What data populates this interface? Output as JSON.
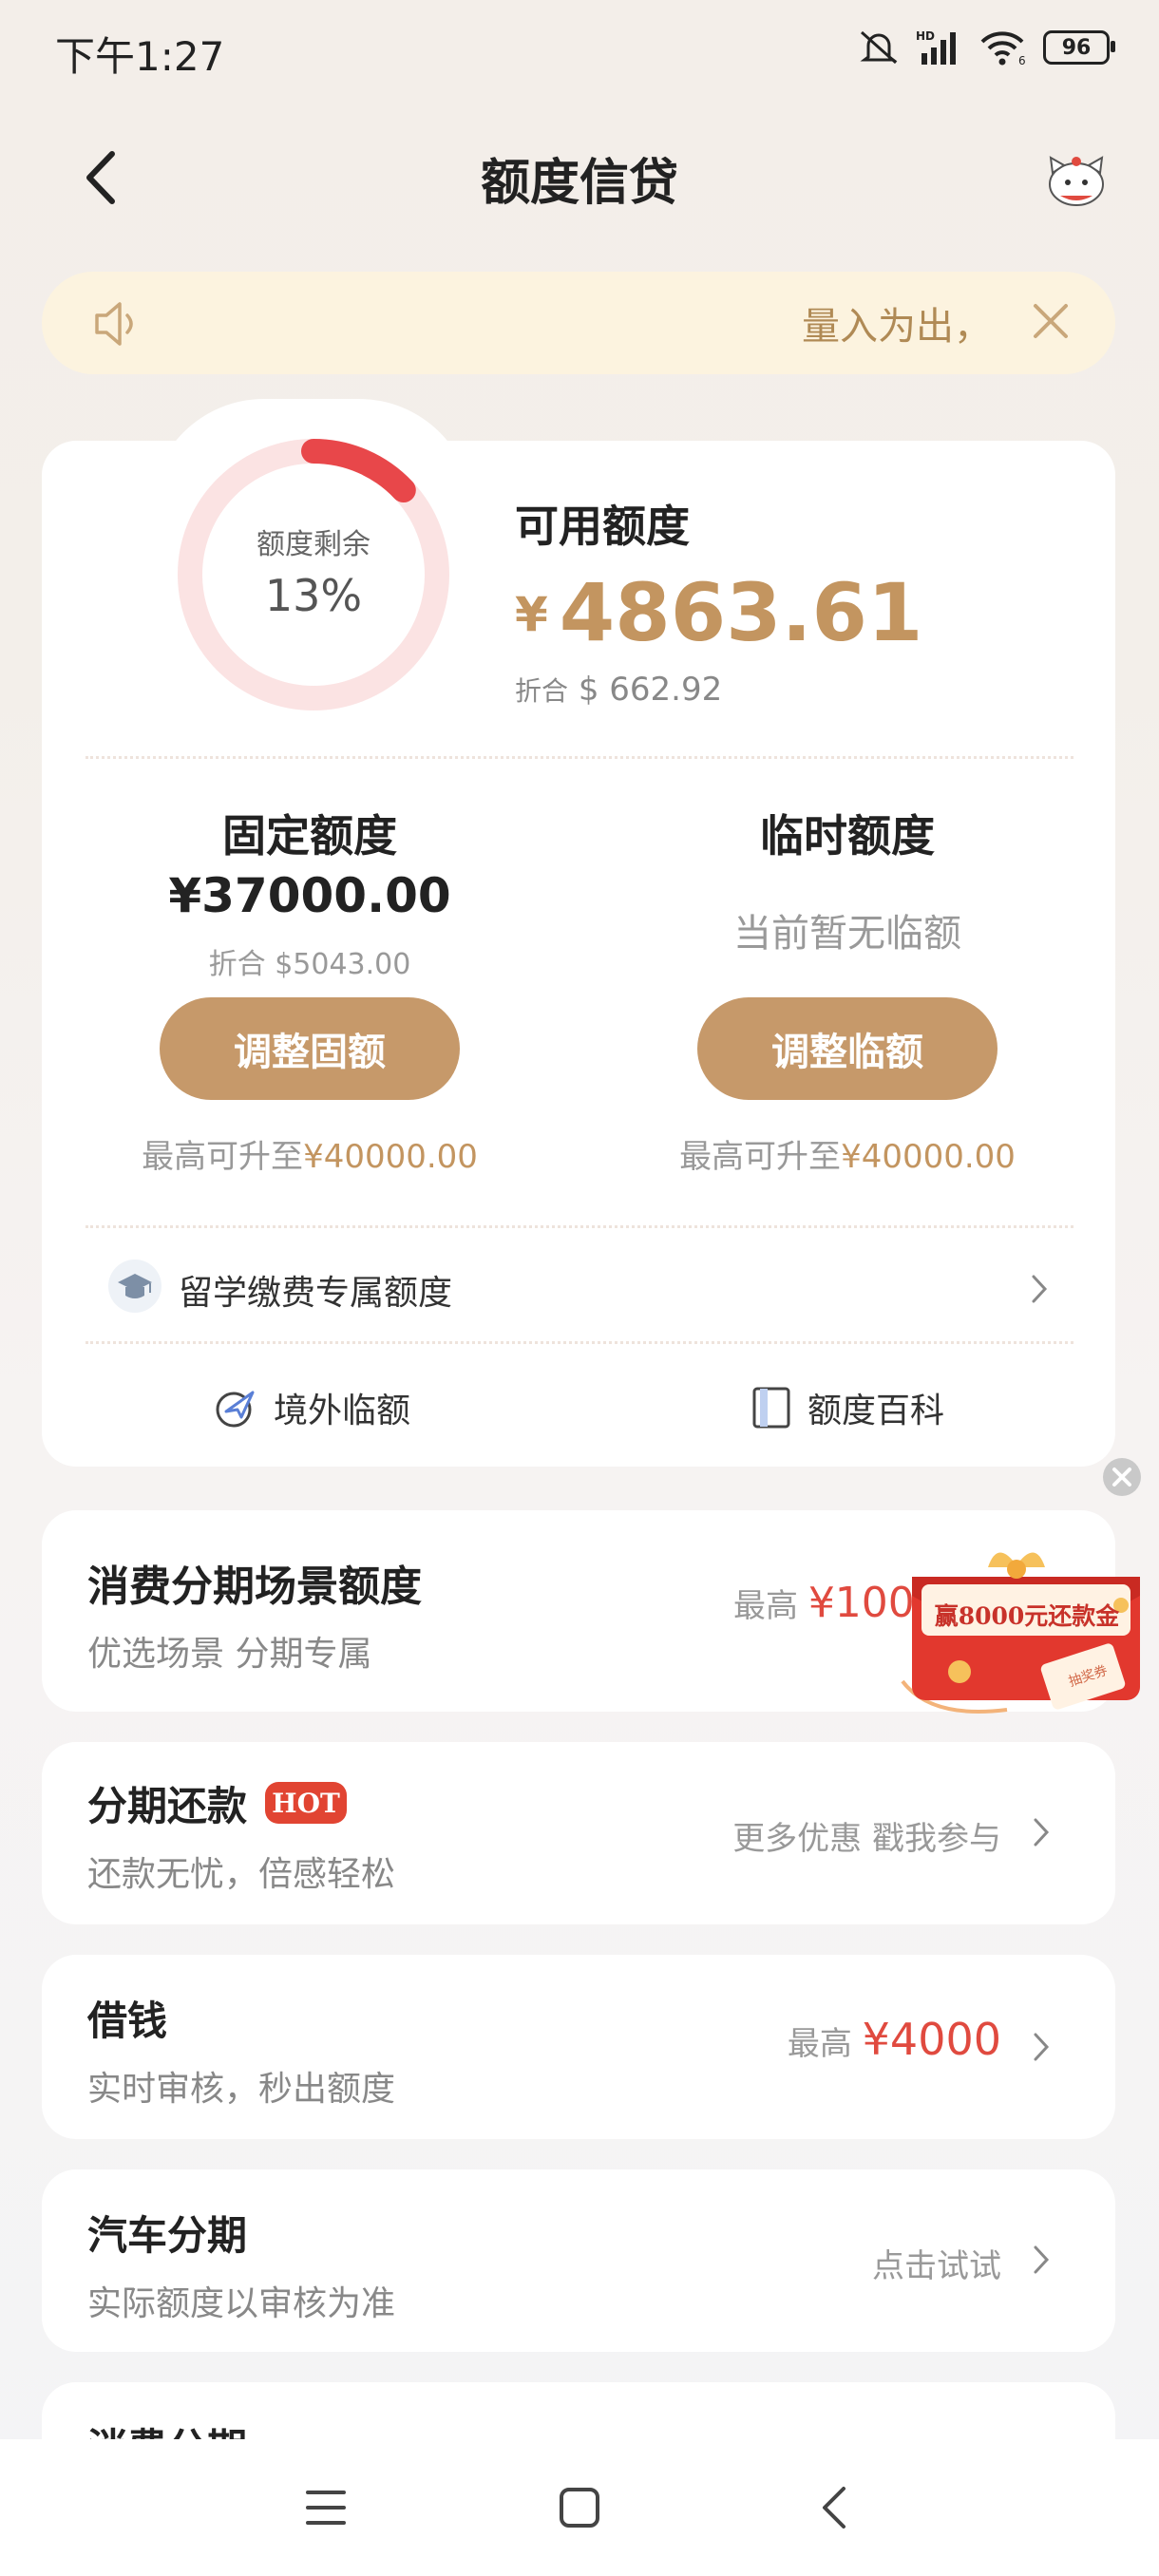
{
  "status": {
    "time": "下午1:27",
    "battery": "96"
  },
  "header": {
    "title": "额度信贷"
  },
  "notice": {
    "text": "量入为出，"
  },
  "quota": {
    "ring_label": "额度剩余",
    "ring_percent": "13%",
    "ring_fraction": 0.13,
    "available_label": "可用额度",
    "currency": "¥",
    "available_amount": "4863.61",
    "conv_label": "折合",
    "conv_currency": "$",
    "conv_amount": "662.92"
  },
  "fixed": {
    "title": "固定额度",
    "amount": "¥37000.00",
    "conv": "折合 $5043.00",
    "button": "调整固额",
    "max_prefix": "最高可升至",
    "max_value": "¥40000.00"
  },
  "temp": {
    "title": "临时额度",
    "none_text": "当前暂无临额",
    "button": "调整临额",
    "max_prefix": "最高可升至",
    "max_value": "¥40000.00"
  },
  "study": {
    "label": "留学缴费专属额度"
  },
  "links": {
    "overseas": "境外临额",
    "wiki": "额度百科"
  },
  "scene": {
    "title": "消费分期场景额度",
    "subtitle": "优选场景 分期专属",
    "right_prefix": "最高",
    "right_value": "¥100",
    "promo": "赢8000元还款金",
    "promo_ticket": "抽奖券"
  },
  "rows": [
    {
      "title": "分期还款",
      "badge": "HOT",
      "subtitle": "还款无忧，倍感轻松",
      "right": "更多优惠 戳我参与"
    },
    {
      "title": "借钱",
      "subtitle": "实时审核，秒出额度",
      "right_prefix": "最高",
      "right_value": "¥4000"
    },
    {
      "title": "汽车分期",
      "subtitle": "实际额度以审核为准",
      "right": "点击试试"
    },
    {
      "title": "消费分期"
    }
  ],
  "colors": {
    "accent": "#c6996a",
    "ring": "#e8474a",
    "red": "#e04a3f"
  }
}
